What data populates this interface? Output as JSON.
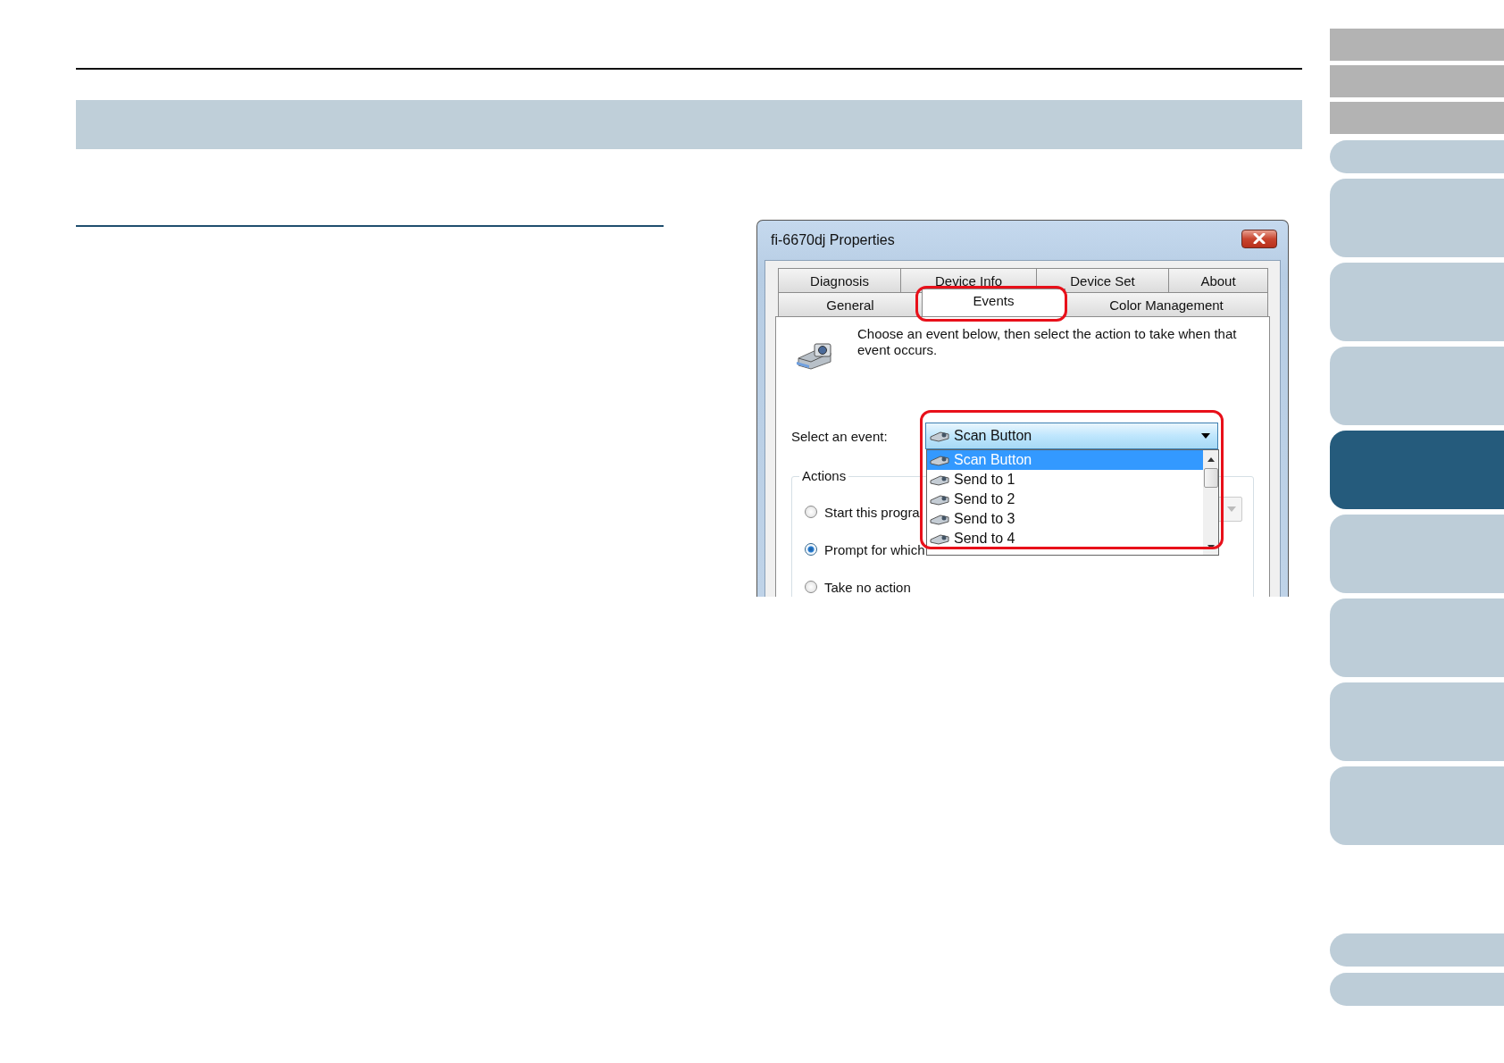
{
  "dialog": {
    "title": "fi-6670dj Properties",
    "tab_rows": [
      [
        {
          "label": "Diagnosis",
          "selected": false
        },
        {
          "label": "Device Info",
          "selected": false
        },
        {
          "label": "Device Set",
          "selected": false
        },
        {
          "label": "About",
          "selected": false
        }
      ],
      [
        {
          "label": "General",
          "selected": false
        },
        {
          "label": "Events",
          "selected": true
        },
        {
          "label": "Color Management",
          "selected": false
        }
      ]
    ],
    "description": "Choose an event below, then select the action to take when that event occurs.",
    "event_label": "Select an event:",
    "event_combo": {
      "value": "Scan Button",
      "expanded": true
    },
    "event_list": [
      {
        "label": "Scan Button",
        "selected": true
      },
      {
        "label": "Send to 1",
        "selected": false
      },
      {
        "label": "Send to 2",
        "selected": false
      },
      {
        "label": "Send to 3",
        "selected": false
      },
      {
        "label": "Send to 4",
        "selected": false
      }
    ],
    "actions": {
      "legend": "Actions",
      "options": [
        {
          "label": "Start this progra",
          "selected": false
        },
        {
          "label": "Prompt for which",
          "selected": true
        },
        {
          "label": "Take no action",
          "selected": false
        }
      ]
    }
  },
  "nav": {
    "top_items": [
      {
        "kind": "block",
        "selected": false
      },
      {
        "kind": "block",
        "selected": false
      },
      {
        "kind": "block",
        "selected": false
      },
      {
        "kind": "short",
        "selected": false
      },
      {
        "kind": "tall",
        "selected": false
      },
      {
        "kind": "tall",
        "selected": false
      },
      {
        "kind": "tall",
        "selected": false
      },
      {
        "kind": "tall",
        "selected": true
      },
      {
        "kind": "tall",
        "selected": false
      },
      {
        "kind": "tall",
        "selected": false
      },
      {
        "kind": "tall",
        "selected": false
      },
      {
        "kind": "tall",
        "selected": false
      }
    ],
    "bottom_items": [
      {
        "kind": "short",
        "selected": false
      },
      {
        "kind": "short",
        "selected": false
      }
    ]
  }
}
